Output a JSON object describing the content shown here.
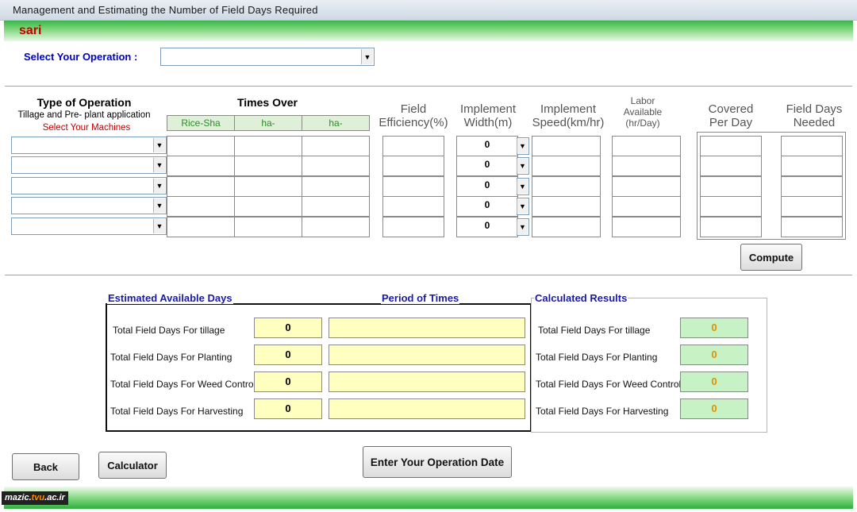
{
  "window": {
    "title": "Management and Estimating the Number of Field Days Required"
  },
  "app": {
    "name": "sari"
  },
  "operation": {
    "label": "Select Your Operation :",
    "value": ""
  },
  "table": {
    "type_header": "Type of Operation",
    "type_sub": "Tillage and Pre- plant application",
    "select_machines": "Select Your Machines",
    "times_over": "Times Over",
    "times_cols": [
      "Rice-Sha",
      "ha-",
      "ha-"
    ],
    "field_efficiency": [
      "Field",
      "Efficiency(%)"
    ],
    "implement_width": [
      "Implement",
      "Width(m)"
    ],
    "implement_speed": [
      "Implement",
      "Speed(km/hr)"
    ],
    "labor": [
      "Labor",
      "Available",
      "(hr/Day)"
    ],
    "covered": [
      "Covered",
      "Per Day"
    ],
    "field_days": [
      "Field Days",
      "Needed"
    ],
    "width_values": [
      "0",
      "0",
      "0",
      "0",
      "0"
    ]
  },
  "buttons": {
    "compute": "Compute",
    "back": "Back",
    "calculator": "Calculator",
    "enter_date": "Enter Your Operation Date"
  },
  "estimated": {
    "title": "Estimated Available Days",
    "period_title": "Period  of  Times",
    "rows": [
      {
        "label": "Total Field Days For tillage",
        "value": "0"
      },
      {
        "label": "Total Field Days For Planting",
        "value": "0"
      },
      {
        "label": "Total Field Days For Weed Control",
        "value": "0"
      },
      {
        "label": "Total Field Days For Harvesting",
        "value": "0"
      }
    ]
  },
  "calculated": {
    "title": "Calculated Results",
    "rows": [
      {
        "label": "Total Field Days For tillage",
        "value": "0"
      },
      {
        "label": "Total Field Days For Planting",
        "value": "0"
      },
      {
        "label": "Total Field Days For Weed Control",
        "value": "0"
      },
      {
        "label": "Total Field Days For Harvesting",
        "value": "0"
      }
    ]
  },
  "watermark": {
    "prefix": "mazic.",
    "highlight": "tvu",
    "suffix": ".ac.ir"
  }
}
